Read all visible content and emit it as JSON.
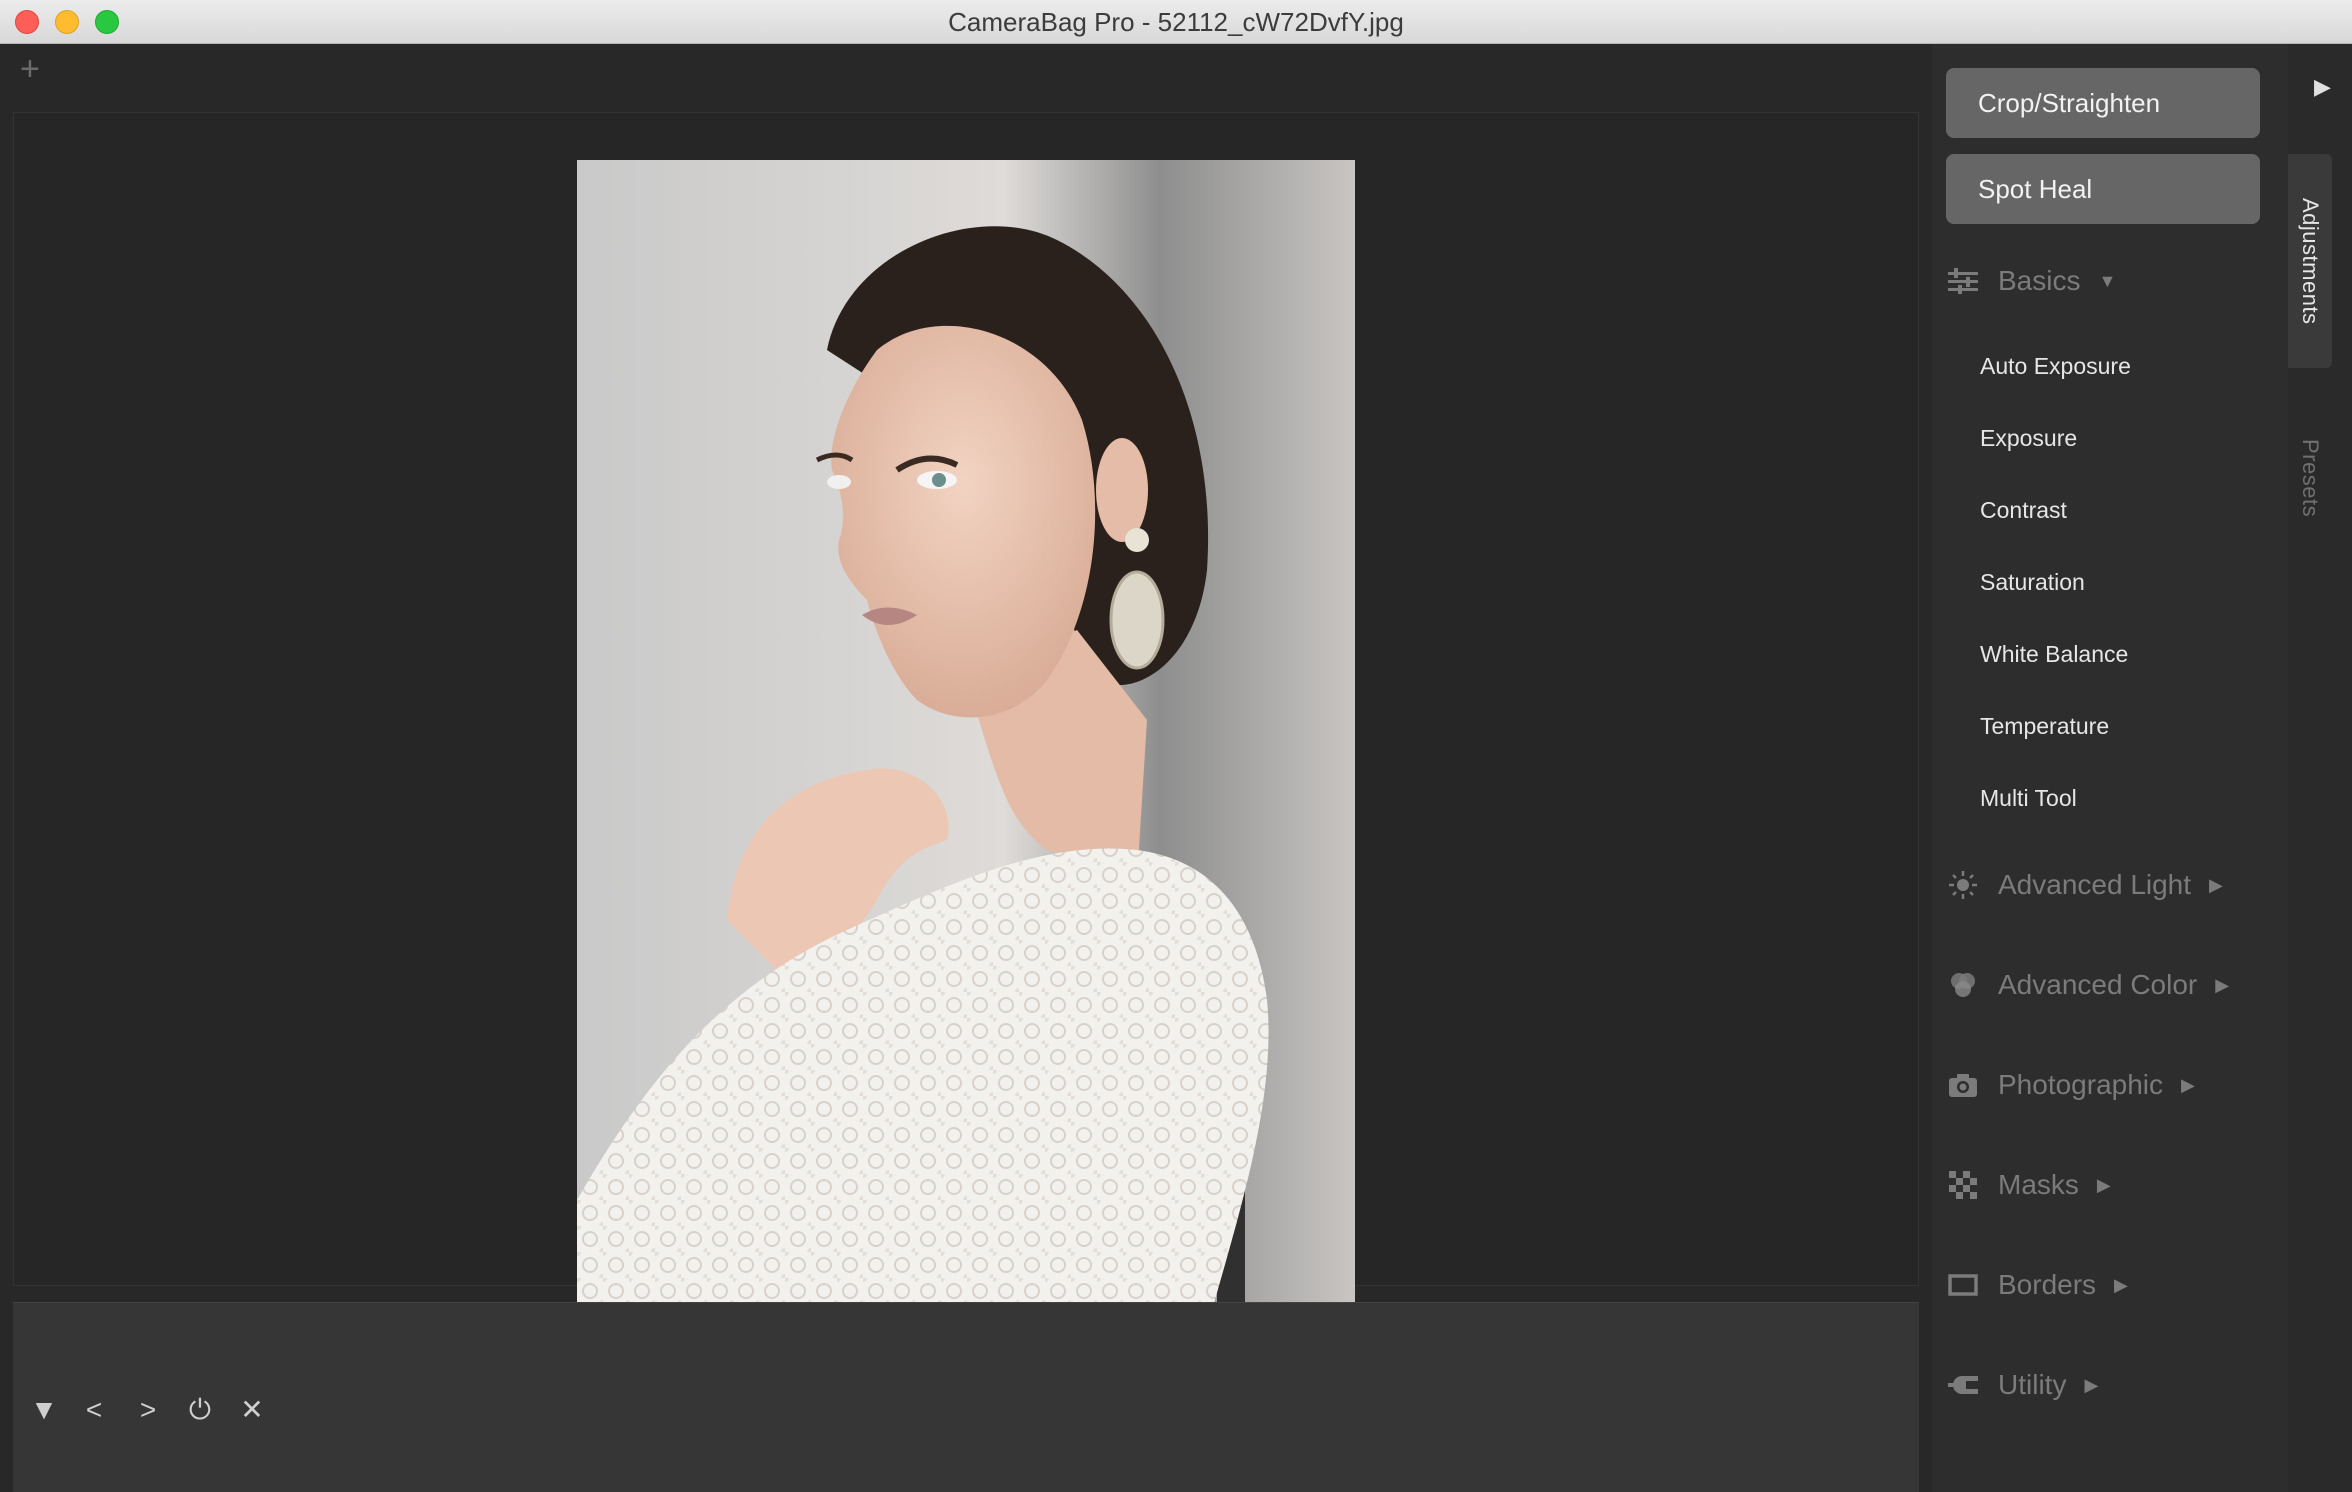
{
  "window": {
    "title": "CameraBag Pro - 52112_cW72DvfY.jpg"
  },
  "canvas": {
    "add_tab_glyph": "+"
  },
  "filmstrip": {
    "buttons": [
      {
        "name": "collapse-icon",
        "glyph": "▼"
      },
      {
        "name": "previous-icon",
        "glyph": "<"
      },
      {
        "name": "next-icon",
        "glyph": ">"
      },
      {
        "name": "power-icon",
        "glyph": "⏻"
      },
      {
        "name": "close-icon",
        "glyph": "✕"
      }
    ]
  },
  "panel": {
    "crop_label": "Crop/Straighten",
    "spot_heal_label": "Spot Heal",
    "basics": {
      "label": "Basics",
      "items": [
        "Auto Exposure",
        "Exposure",
        "Contrast",
        "Saturation",
        "White Balance",
        "Temperature",
        "Multi Tool"
      ]
    },
    "sections": [
      {
        "label": "Advanced Light",
        "icon": "sun-icon"
      },
      {
        "label": "Advanced Color",
        "icon": "color-circles-icon"
      },
      {
        "label": "Photographic",
        "icon": "camera-icon"
      },
      {
        "label": "Masks",
        "icon": "checker-icon"
      },
      {
        "label": "Borders",
        "icon": "border-icon"
      },
      {
        "label": "Utility",
        "icon": "plug-icon"
      }
    ]
  },
  "rail": {
    "tabs": {
      "adjustments": "Adjustments",
      "presets": "Presets"
    }
  },
  "colors": {
    "accent_button": "#666666",
    "panel_bg": "#2d2d2d",
    "canvas_bg": "#262626"
  }
}
